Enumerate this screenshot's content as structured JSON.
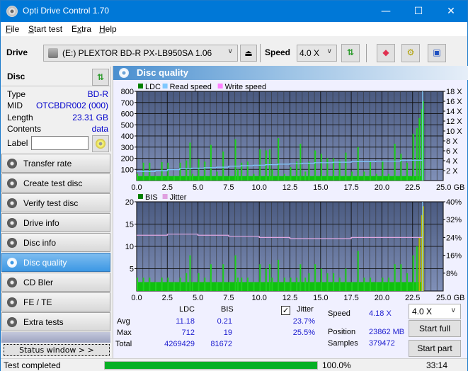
{
  "window": {
    "title": "Opti Drive Control 1.70",
    "controls": {
      "minimize": "—",
      "maximize": "☐",
      "close": "✕"
    }
  },
  "menu": {
    "items": [
      {
        "label": "File",
        "accel": "F"
      },
      {
        "label": "Start test",
        "accel": "S"
      },
      {
        "label": "Extra",
        "accel": "x"
      },
      {
        "label": "Help",
        "accel": "H"
      }
    ]
  },
  "toolbar": {
    "drive_label": "Drive",
    "drive_value": "(E:)  PLEXTOR BD-R  PX-LB950SA 1.06",
    "speed_label": "Speed",
    "speed_value": "4.0 X",
    "icons": [
      "eject-icon",
      "refresh-icon",
      "eraser-icon",
      "settings-icon",
      "save-icon"
    ]
  },
  "disc": {
    "header": "Disc",
    "fields": [
      {
        "key": "Type",
        "value": "BD-R"
      },
      {
        "key": "MID",
        "value": "OTCBDR002 (000)"
      },
      {
        "key": "Length",
        "value": "23.31 GB"
      },
      {
        "key": "Contents",
        "value": "data"
      }
    ],
    "label_key": "Label",
    "label_value": ""
  },
  "nav": {
    "items": [
      {
        "label": "Transfer rate",
        "active": false
      },
      {
        "label": "Create test disc",
        "active": false
      },
      {
        "label": "Verify test disc",
        "active": false
      },
      {
        "label": "Drive info",
        "active": false
      },
      {
        "label": "Disc info",
        "active": false
      },
      {
        "label": "Disc quality",
        "active": true
      },
      {
        "label": "CD Bler",
        "active": false
      },
      {
        "label": "FE / TE",
        "active": false
      },
      {
        "label": "Extra tests",
        "active": false
      }
    ],
    "status_window": "Status window > >"
  },
  "panel": {
    "title": "Disc quality"
  },
  "chart_data": [
    {
      "type": "bar",
      "title": "LDC / Read speed",
      "legend": [
        {
          "name": "LDC",
          "color": "#008000"
        },
        {
          "name": "Read speed",
          "color": "#80c8ff"
        },
        {
          "name": "Write speed",
          "color": "#ff80ff"
        }
      ],
      "legend_position": "top-left",
      "xlabel": "GB",
      "xlim": [
        0,
        25
      ],
      "x_ticks": [
        "0.0",
        "2.5",
        "5.0",
        "7.5",
        "10.0",
        "12.5",
        "15.0",
        "17.5",
        "20.0",
        "22.5",
        "25.0 GB"
      ],
      "ylim_left": [
        0,
        800
      ],
      "y_ticks_left": [
        "100",
        "200",
        "300",
        "400",
        "500",
        "600",
        "700",
        "800"
      ],
      "ylim_right": [
        0,
        18
      ],
      "y_ticks_right": [
        "2 X",
        "4 X",
        "6 X",
        "8 X",
        "10 X",
        "12 X",
        "14 X",
        "16 X",
        "18 X"
      ],
      "grid": true,
      "series": [
        {
          "name": "LDC",
          "x": [
            0.0,
            0.5,
            1.0,
            1.5,
            2.0,
            2.5,
            3.0,
            3.5,
            4.0,
            4.3,
            4.5,
            5.0,
            5.5,
            6.0,
            6.5,
            7.0,
            7.5,
            8.0,
            8.2,
            8.5,
            9.0,
            9.5,
            10.0,
            10.5,
            10.8,
            11.0,
            11.5,
            12.0,
            12.5,
            13.0,
            13.3,
            13.7,
            14.0,
            14.5,
            15.0,
            15.5,
            16.0,
            16.5,
            17.0,
            17.5,
            18.0,
            18.5,
            19.0,
            19.5,
            20.0,
            20.5,
            21.0,
            21.5,
            22.0,
            22.5,
            22.8,
            23.0,
            23.2,
            23.31
          ],
          "values": [
            60,
            160,
            160,
            40,
            165,
            160,
            40,
            160,
            180,
            340,
            60,
            190,
            170,
            320,
            80,
            260,
            40,
            370,
            100,
            160,
            170,
            60,
            280,
            270,
            280,
            100,
            380,
            60,
            120,
            170,
            330,
            80,
            170,
            270,
            240,
            200,
            200,
            180,
            250,
            80,
            300,
            80,
            170,
            60,
            170,
            60,
            330,
            240,
            160,
            420,
            470,
            560,
            640,
            712
          ]
        },
        {
          "name": "Read speed",
          "unit": "X",
          "x": [
            0.0,
            1.5,
            2.5,
            3.5,
            4.5,
            5.5,
            6.5,
            7.5,
            8.5,
            9.5,
            10.5,
            11.5,
            12.5,
            13.5,
            14.5,
            16.0,
            17.5,
            19.5,
            21.5,
            23.31
          ],
          "values": [
            1.8,
            2.0,
            2.2,
            2.4,
            2.5,
            2.6,
            2.7,
            2.9,
            3.0,
            3.1,
            3.2,
            3.3,
            3.4,
            3.5,
            3.6,
            3.7,
            3.8,
            3.9,
            4.1,
            4.2
          ]
        }
      ]
    },
    {
      "type": "bar",
      "title": "BIS / Jitter",
      "legend": [
        {
          "name": "BIS",
          "color": "#008000"
        },
        {
          "name": "Jitter",
          "color": "#e0a0e0"
        }
      ],
      "legend_position": "top-left",
      "xlabel": "GB",
      "xlim": [
        0,
        25
      ],
      "x_ticks": [
        "0.0",
        "2.5",
        "5.0",
        "7.5",
        "10.0",
        "12.5",
        "15.0",
        "17.5",
        "20.0",
        "22.5",
        "25.0 GB"
      ],
      "ylim_left": [
        0,
        20
      ],
      "y_ticks_left": [
        "5",
        "10",
        "15",
        "20"
      ],
      "ylim_right": [
        0,
        40
      ],
      "y_ticks_right": [
        "8%",
        "16%",
        "24%",
        "32%",
        "40%"
      ],
      "grid": true,
      "series": [
        {
          "name": "BIS",
          "x": [
            0.0,
            0.5,
            1.0,
            1.5,
            2.0,
            2.5,
            3.0,
            3.5,
            4.0,
            4.3,
            4.5,
            5.0,
            5.5,
            6.0,
            6.5,
            7.0,
            7.5,
            8.0,
            8.2,
            8.5,
            9.0,
            9.5,
            10.0,
            10.5,
            10.8,
            11.0,
            11.5,
            12.0,
            12.5,
            13.0,
            13.3,
            13.7,
            14.0,
            14.5,
            15.0,
            15.5,
            16.0,
            16.5,
            17.0,
            17.5,
            18.0,
            18.5,
            19.0,
            19.5,
            20.0,
            20.5,
            21.0,
            21.5,
            22.0,
            22.5,
            22.8,
            23.0,
            23.2,
            23.31
          ],
          "values": [
            3,
            3,
            3,
            2,
            3,
            3,
            2,
            3,
            4,
            8,
            2,
            4,
            3,
            6,
            2,
            6,
            2,
            8,
            3,
            3,
            3,
            2,
            6,
            5,
            6,
            3,
            7,
            3,
            3,
            3,
            6,
            3,
            4,
            6,
            5,
            4,
            4,
            3,
            5,
            2,
            9,
            3,
            3,
            2,
            3,
            3,
            6,
            6,
            4,
            8,
            10,
            12,
            17,
            19
          ]
        },
        {
          "name": "Jitter",
          "unit": "%",
          "x": [
            0.0,
            2.5,
            5.0,
            7.5,
            10.0,
            12.5,
            15.0,
            17.5,
            20.0,
            22.5,
            23.31
          ],
          "values": [
            25.0,
            25.5,
            25.0,
            24.5,
            24.0,
            23.5,
            23.5,
            24.0,
            24.0,
            24.0,
            24.5
          ]
        }
      ]
    }
  ],
  "stats": {
    "col_ldc": "LDC",
    "col_bis": "BIS",
    "jitter_label": "Jitter",
    "jitter_checked": true,
    "rows": [
      {
        "label": "Avg",
        "ldc": "11.18",
        "bis": "0.21",
        "jitter": "23.7%"
      },
      {
        "label": "Max",
        "ldc": "712",
        "bis": "19",
        "jitter": "25.5%"
      },
      {
        "label": "Total",
        "ldc": "4269429",
        "bis": "81672",
        "jitter": ""
      }
    ],
    "speed_label": "Speed",
    "speed_value": "4.18 X",
    "position_label": "Position",
    "position_value": "23862 MB",
    "samples_label": "Samples",
    "samples_value": "379472",
    "speed_select": "4.0 X",
    "start_full": "Start full",
    "start_part": "Start part"
  },
  "statusbar": {
    "status_text": "Test completed",
    "progress": 100.0,
    "progress_text": "100.0%",
    "elapsed": "33:14"
  }
}
